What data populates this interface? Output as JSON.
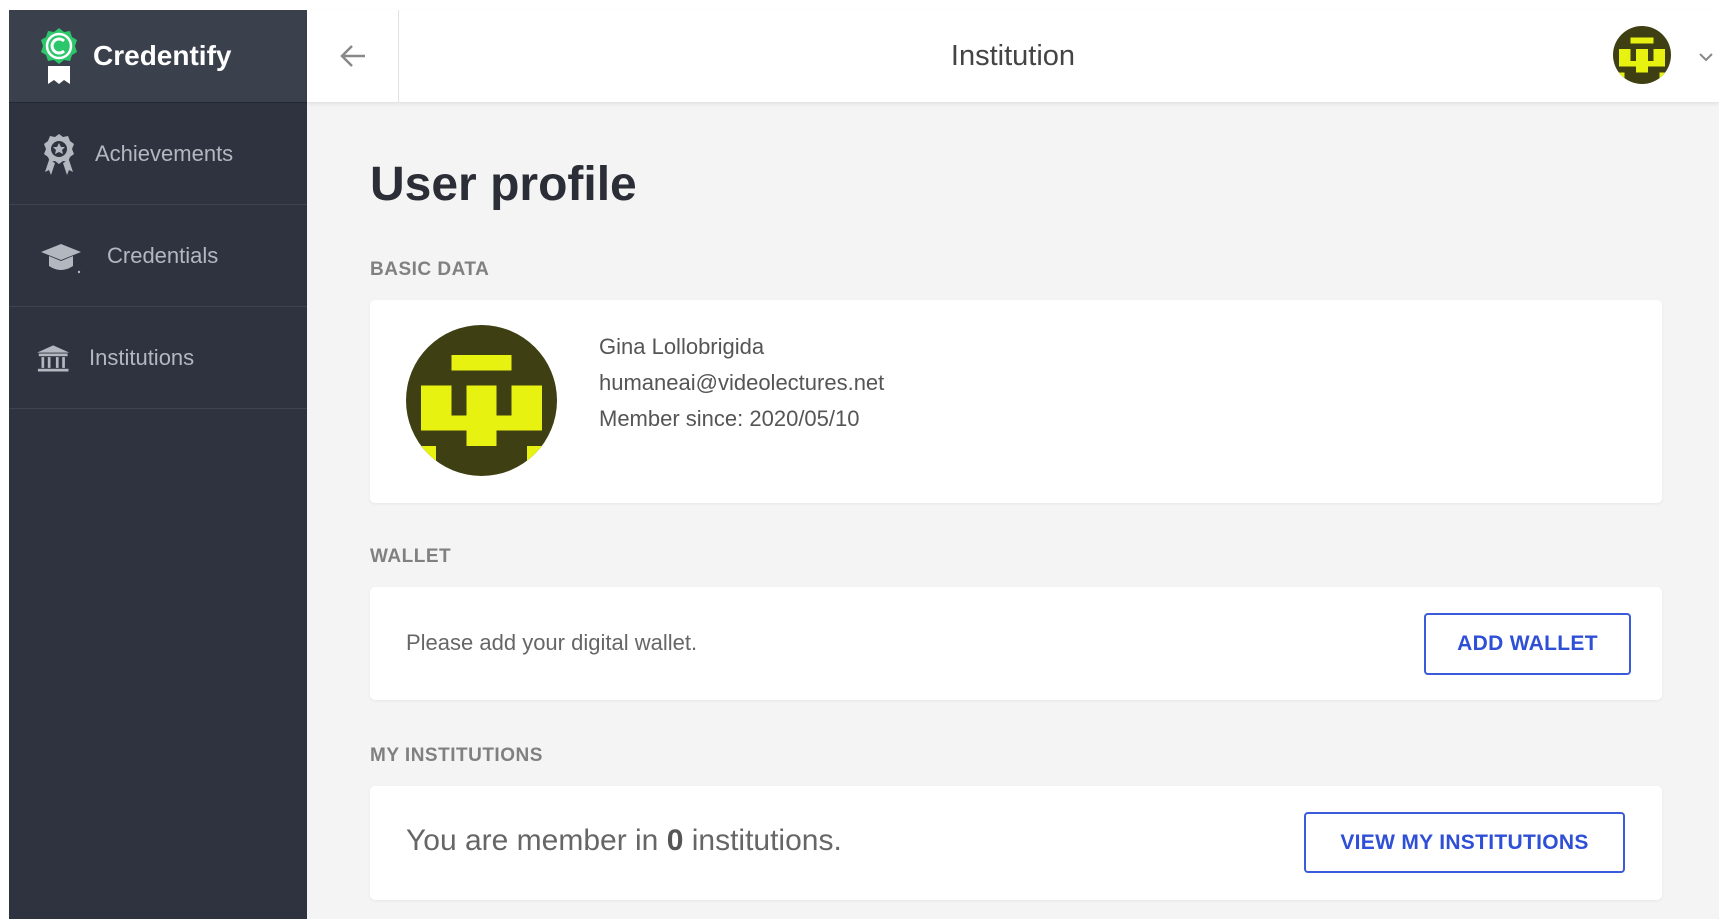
{
  "app": {
    "brand_name": "Credentify"
  },
  "sidebar": {
    "items": [
      {
        "label": "Achievements",
        "icon": "award-ribbon-icon"
      },
      {
        "label": "Credentials",
        "icon": "graduation-cap-icon"
      },
      {
        "label": "Institutions",
        "icon": "institution-building-icon"
      }
    ]
  },
  "header": {
    "title": "Institution",
    "back_icon": "arrow-left-icon",
    "menu_icon": "chevron-down-icon"
  },
  "page": {
    "title": "User profile"
  },
  "basic_data": {
    "label": "BASIC DATA",
    "name": "Gina Lollobrigida",
    "email": "humaneai@videolectures.net",
    "member_since": "Member since: 2020/05/10"
  },
  "wallet": {
    "label": "WALLET",
    "message": "Please add your digital wallet.",
    "button_label": "ADD WALLET"
  },
  "institutions": {
    "label": "MY INSTITUTIONS",
    "text_prefix": "You are member in ",
    "count": "0",
    "text_suffix": " institutions.",
    "button_label": "VIEW MY INSTITUTIONS"
  },
  "colors": {
    "sidebar_bg": "#2e333f",
    "brand_bg": "#3b404d",
    "accent": "#2f4fd6",
    "logo_green": "#2bc76a",
    "avatar_bg": "#3f3f14",
    "avatar_fg": "#e8f211"
  }
}
